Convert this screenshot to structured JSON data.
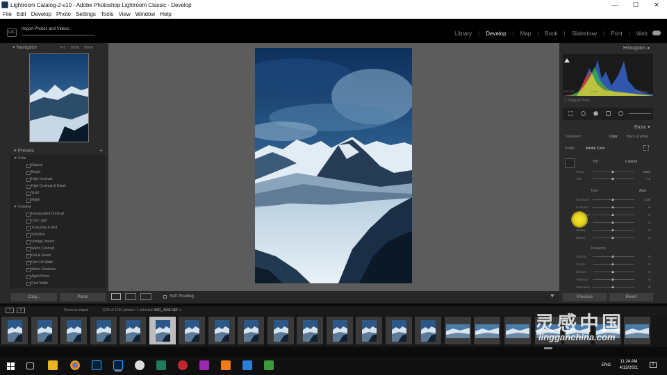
{
  "window": {
    "title": "Lightroom Catalog-2-v10 - Adobe Photoshop Lightroom Classic - Develop",
    "minimize": "—",
    "maximize": "☐",
    "close": "✕"
  },
  "menu": [
    "File",
    "Edit",
    "Develop",
    "Photo",
    "Settings",
    "Tools",
    "View",
    "Window",
    "Help"
  ],
  "header": {
    "badge": "LrC",
    "import_label": "Import Photos and Videos",
    "modules": [
      "Library",
      "Develop",
      "Map",
      "Book",
      "Slideshow",
      "Print",
      "Web"
    ],
    "active_module": "Develop"
  },
  "navigator": {
    "title": "Navigator",
    "opts": [
      "FIT",
      "100%",
      "300%"
    ]
  },
  "presets": {
    "title": "Presets",
    "groups": [
      {
        "name": "Color",
        "items": [
          "Natural",
          "Bright",
          "High Contrast",
          "High Contrast & Detail",
          "Vivid",
          "Matte"
        ]
      },
      {
        "name": "Creative",
        "items": [
          "Desaturated Contrast",
          "Cool Light",
          "Turquoise & Red",
          "Soft Mist",
          "Vintage Instant",
          "Warm Contrast",
          "Flat & Green",
          "Red Lift Matte",
          "Warm Shadows",
          "Aged Photo",
          "Cool Matte"
        ]
      }
    ]
  },
  "left_buttons": {
    "copy": "Copy...",
    "paste": "Paste"
  },
  "toolbar": {
    "soft_proofing": "Soft Proofing"
  },
  "histogram": {
    "title": "Histogram",
    "readout": [
      "ISO 100",
      "14 mm",
      "f / 8.0",
      "1/400 sec"
    ],
    "original_photo": "Original Photo"
  },
  "basic": {
    "title": "Basic",
    "treatment_label": "Treatment :",
    "treatment_color": "Color",
    "treatment_bw": "Black & White",
    "profile_label": "Profile :",
    "profile_value": "Adobe Color",
    "wb_label": "WB :",
    "wb_value": "Custom",
    "tone_label": "Tone",
    "auto_label": "Auto",
    "presence_label": "Presence",
    "wb_sliders": [
      {
        "name": "Temp",
        "value": "5900"
      },
      {
        "name": "Tint",
        "value": "+ 6"
      }
    ],
    "tone_sliders": [
      {
        "name": "Exposure",
        "value": "0.00"
      },
      {
        "name": "Contrast",
        "value": "0"
      },
      {
        "name": "Highlights",
        "value": "0"
      },
      {
        "name": "Shadows",
        "value": "0"
      },
      {
        "name": "Whites",
        "value": "0"
      },
      {
        "name": "Blacks",
        "value": "0"
      }
    ],
    "presence_sliders": [
      {
        "name": "Texture",
        "value": "0"
      },
      {
        "name": "Clarity",
        "value": "0"
      },
      {
        "name": "Dehaze",
        "value": "0"
      },
      {
        "name": "Vibrance",
        "value": "0"
      },
      {
        "name": "Saturation",
        "value": "0"
      }
    ]
  },
  "right_buttons": {
    "previous": "Previous",
    "reset": "Reset"
  },
  "filmstrip": {
    "pages": [
      "1",
      "2"
    ],
    "source": "Previous Import",
    "count": "1226 of 1226 photos / 1 selected",
    "file": "/IMG_4436.NEF"
  },
  "watermark": {
    "text": "灵感中国",
    "url": "lingganchina.com"
  },
  "taskbar": {
    "lang": "ENG",
    "time": "11:24 AM",
    "date": "4/13/2021",
    "notifications": "2"
  },
  "colors": {
    "accent": "#e6e6e6",
    "panel": "#2a2a2a",
    "canvas": "#5c5c5c",
    "cursor": "#f5ea3a"
  }
}
